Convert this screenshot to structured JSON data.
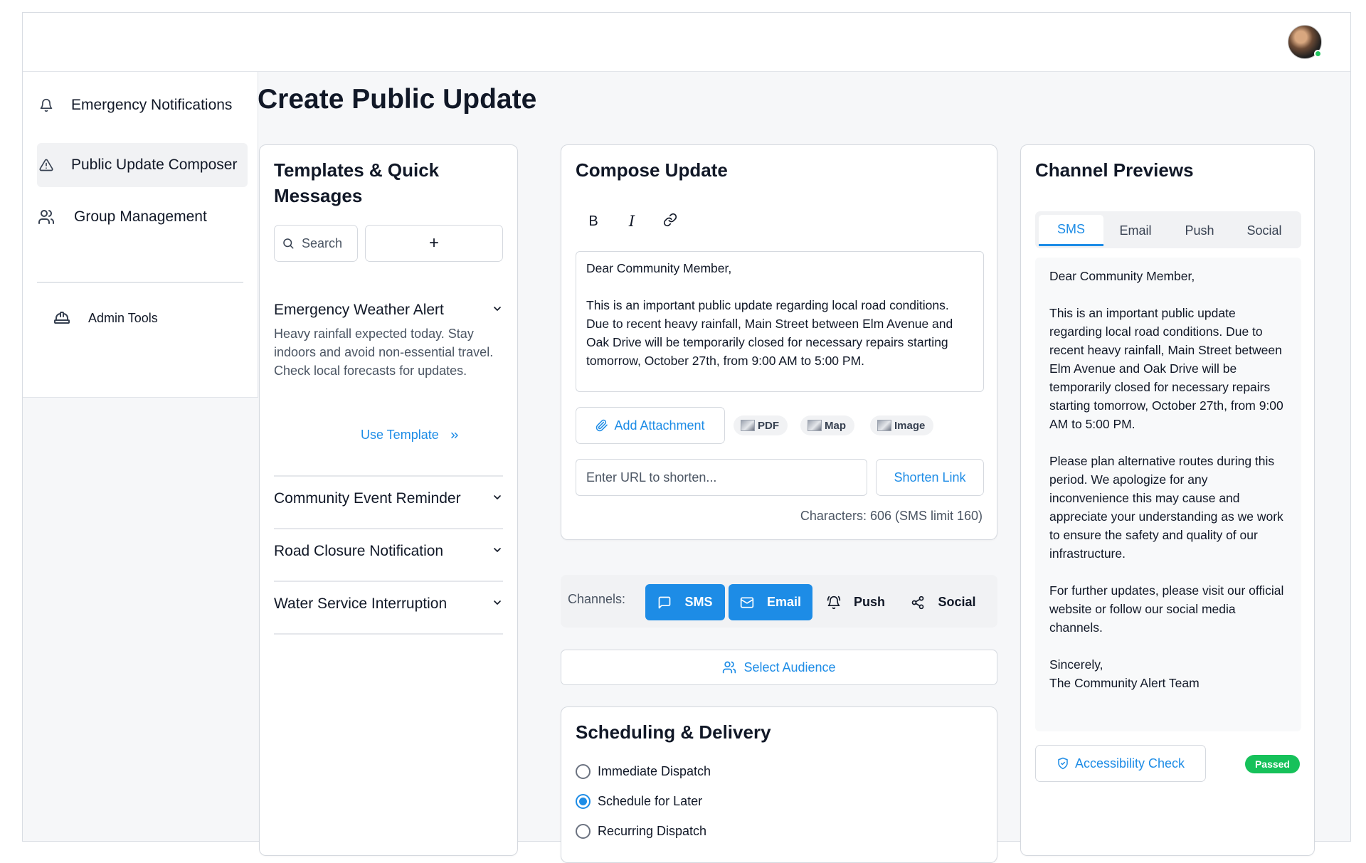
{
  "page": {
    "title": "Create Public Update"
  },
  "sidebar": {
    "items": [
      {
        "label": "Emergency Notifications",
        "icon": "bell-icon"
      },
      {
        "label": "Public Update Composer",
        "icon": "warning-triangle-icon"
      },
      {
        "label": "Group Management",
        "icon": "users-icon"
      }
    ],
    "admin": {
      "label": "Admin Tools",
      "icon": "hard-hat-icon"
    }
  },
  "templates": {
    "title": "Templates & Quick Messages",
    "search_label": "Search",
    "add_label": "+",
    "items": [
      {
        "title": "Emergency Weather Alert",
        "expanded": true,
        "description": "Heavy rainfall expected today. Stay indoors and avoid non-essential travel. Check local forecasts for updates.",
        "action": "Use Template"
      },
      {
        "title": "Community Event Reminder",
        "expanded": false
      },
      {
        "title": "Road Closure Notification",
        "expanded": false
      },
      {
        "title": "Water Service Interruption",
        "expanded": false
      }
    ]
  },
  "compose": {
    "title": "Compose Update",
    "toolbar": {
      "bold": "B",
      "italic": "I",
      "link": "link-icon"
    },
    "body": "Dear Community Member,\n\nThis is an important public update regarding local road conditions. Due to recent heavy rainfall, Main Street between Elm Avenue and Oak Drive will be temporarily closed for necessary repairs starting tomorrow, October 27th, from 9:00 AM to 5:00 PM.",
    "add_attachment": "Add Attachment",
    "attachments": [
      "PDF",
      "Map",
      "Image"
    ],
    "url_placeholder": "Enter URL to shorten...",
    "shorten_label": "Shorten Link",
    "char_count": "Characters: 606 (SMS limit 160)"
  },
  "channels": {
    "label": "Channels:",
    "items": [
      {
        "label": "SMS",
        "active": true,
        "icon": "message-icon"
      },
      {
        "label": "Email",
        "active": true,
        "icon": "mail-icon"
      },
      {
        "label": "Push",
        "active": false,
        "icon": "bell-ring-icon"
      },
      {
        "label": "Social",
        "active": false,
        "icon": "share-icon"
      }
    ]
  },
  "audience": {
    "label": "Select Audience"
  },
  "scheduling": {
    "title": "Scheduling & Delivery",
    "options": [
      {
        "label": "Immediate Dispatch",
        "checked": false
      },
      {
        "label": "Schedule for Later",
        "checked": true
      },
      {
        "label": "Recurring Dispatch",
        "checked": false
      }
    ]
  },
  "previews": {
    "title": "Channel Previews",
    "tabs": [
      "SMS",
      "Email",
      "Push",
      "Social"
    ],
    "active_tab": "SMS",
    "text": "Dear Community Member,\n\nThis is an important public update regarding local road conditions. Due to recent heavy rainfall, Main Street between Elm Avenue and Oak Drive will be temporarily closed for necessary repairs starting tomorrow, October 27th, from 9:00 AM to 5:00 PM.\n\nPlease plan alternative routes during this period. We apologize for any inconvenience this may cause and appreciate your understanding as we work to ensure the safety and quality of our infrastructure.\n\nFor further updates, please visit our official website or follow our social media channels.\n\nSincerely,\nThe Community Alert Team",
    "accessibility_label": "Accessibility Check",
    "status": "Passed"
  },
  "colors": {
    "accent": "#1d8ce6",
    "success": "#16c15a",
    "panel_bg": "#f1f2f4"
  }
}
